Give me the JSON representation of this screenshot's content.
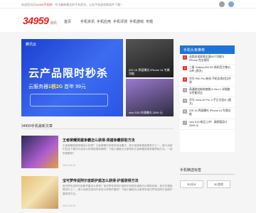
{
  "topbar": {
    "message_prefix": "欢迎您访问",
    "message_site": "34959手机网",
    "message_rest": "！专注最新最全的手机资讯，以及手机游戏和软件下载！"
  },
  "header": {
    "logo_main": "34959",
    "logo_sub": "资讯",
    "nav": [
      "首页",
      "手机资讯",
      "手机应用",
      "手机评测",
      "手机游戏",
      "专题"
    ]
  },
  "hero": {
    "brand": "腾讯云",
    "title": "云产品限时秒杀",
    "offer_prefix": "云服务器",
    "offer_spec": "1核2G",
    "offer_rest": " 首年 99元"
  },
  "thumbs": [
    {
      "caption": "iOS 16 界面曝光 iPhone 14 专属功能"
    },
    {
      "caption": "vivo S15 外观曝光 3299 元"
    },
    {
      "caption": ""
    }
  ],
  "section": {
    "title": "34959手机最新文章"
  },
  "articles": [
    {
      "title": "王者荣耀英雄争霸怎么获得-英雄争霸获取方法",
      "desc": "王者荣耀英雄争霸怎么获得？王者荣耀中有很多游戏模式，其中英雄争霸就是其中之一，那么玩家们在这个模式中该怎么获得英雄争霸呢？下面小编就为大家带来王者荣耀英雄争霸获取方法，一起来看看吧！",
      "meta": "2022-06-20"
    },
    {
      "title": "宝可梦传说阿尔宙斯护盾怎么获得-护盾获得方法",
      "desc": "宝可梦传说阿尔宙斯护盾怎么获得？宝可梦传说阿尔宙斯中有很多道具可以帮助玩家，其中护盾就是其中之一，那么玩家在游戏中该怎么获得护盾呢？下面小编就为大家带来宝可梦传说阿尔宙斯护盾获得方法。",
      "meta": "2022-06-20"
    }
  ],
  "sidebar": {
    "title": "手机头条推荐",
    "items": [
      "英国出现屏幕全面BOT功能与iPhone 完全相同",
      "三星 Galaxy A53 5G 新机官方售价公布 (图文)",
      "华为 P50 Pro 新机 手机实测对比评测",
      "高通骁龙新款旗舰 8 Gen 1 详细跑分性能对比",
      "华为 nova 10 Pro 入手正式定价 (图文)",
      "iOS 16 界面曝光 iPhone 14 专属功能",
      "vivo S15 新品上市！高颜值设计 3299 元"
    ]
  },
  "side2": {
    "title": "手机精选标签",
    "tags": [
      "3D设计",
      "3D游戏"
    ]
  },
  "colors": {
    "brand": "#e02020",
    "accent": "#1e73d6"
  }
}
